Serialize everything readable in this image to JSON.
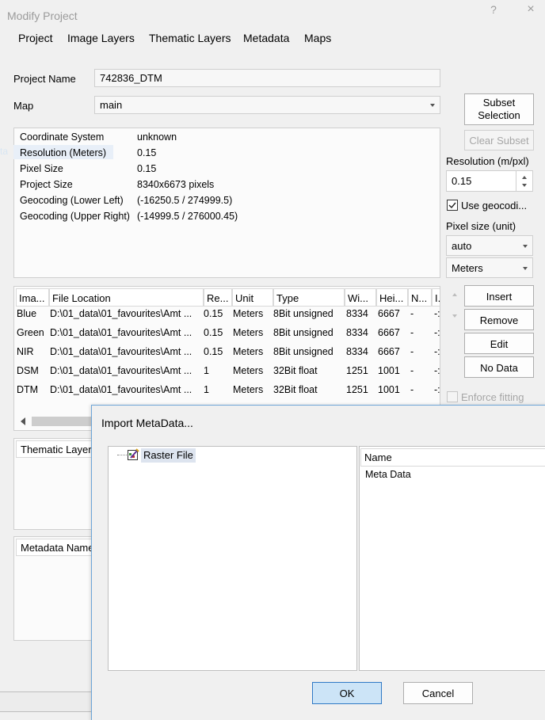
{
  "window": {
    "title": "Modify Project",
    "help_glyph": "?",
    "close_glyph": "×"
  },
  "tabs": [
    "Project",
    "Image Layers",
    "Thematic Layers",
    "Metadata",
    "Maps"
  ],
  "project_name": {
    "label": "Project Name",
    "value": "742836_DTM"
  },
  "map": {
    "label": "Map",
    "value": "main"
  },
  "info": [
    {
      "key": "Coordinate System",
      "value": "unknown"
    },
    {
      "key": "Resolution (Meters)",
      "value": "0.15"
    },
    {
      "key": "Pixel Size",
      "value": "0.15"
    },
    {
      "key": "Project Size",
      "value": "8340x6673 pixels"
    },
    {
      "key": "Geocoding (Lower Left)",
      "value": "(-16250.5 / 274999.5)"
    },
    {
      "key": "Geocoding (Upper Right)",
      "value": "(-14999.5 / 276000.45)"
    }
  ],
  "ghost_text": "ta",
  "right_panel": {
    "subset_selection": "Subset Selection",
    "clear_subset": "Clear Subset",
    "resolution_label": "Resolution (m/pxl)",
    "resolution_value": "0.15",
    "use_geocoding": "Use geocodi...",
    "pixel_size_label": "Pixel size (unit)",
    "pixel_size_value": "auto",
    "unit_value": "Meters",
    "insert": "Insert",
    "remove": "Remove",
    "edit": "Edit",
    "no_data": "No Data",
    "enforce_fitting": "Enforce fitting"
  },
  "layers_table": {
    "columns": [
      "Ima...",
      "File Location",
      "Re...",
      "Unit",
      "Type",
      "Wi...",
      "Hei...",
      "N...",
      "I..."
    ],
    "rows": [
      [
        "Blue",
        "D:\\01_data\\01_favourites\\Amt ...",
        "0.15",
        "Meters",
        "8Bit unsigned",
        "8334",
        "6667",
        "-",
        "-:"
      ],
      [
        "Green",
        "D:\\01_data\\01_favourites\\Amt ...",
        "0.15",
        "Meters",
        "8Bit unsigned",
        "8334",
        "6667",
        "-",
        "-:"
      ],
      [
        "NIR",
        "D:\\01_data\\01_favourites\\Amt ...",
        "0.15",
        "Meters",
        "8Bit unsigned",
        "8334",
        "6667",
        "-",
        "-:"
      ],
      [
        "DSM",
        "D:\\01_data\\01_favourites\\Amt ...",
        "1",
        "Meters",
        "32Bit float",
        "1251",
        "1001",
        "-",
        "-:"
      ],
      [
        "DTM",
        "D:\\01_data\\01_favourites\\Amt ...",
        "1",
        "Meters",
        "32Bit float",
        "1251",
        "1001",
        "-",
        "-:"
      ]
    ]
  },
  "thematic_panel": {
    "header": "Thematic Layer"
  },
  "metadata_panel": {
    "header": "Metadata Name"
  },
  "import_dialog": {
    "title": "Import MetaData...",
    "tree_item": "Raster File",
    "list_header": "Name",
    "list_item": "Meta Data",
    "ok": "OK",
    "cancel": "Cancel"
  }
}
